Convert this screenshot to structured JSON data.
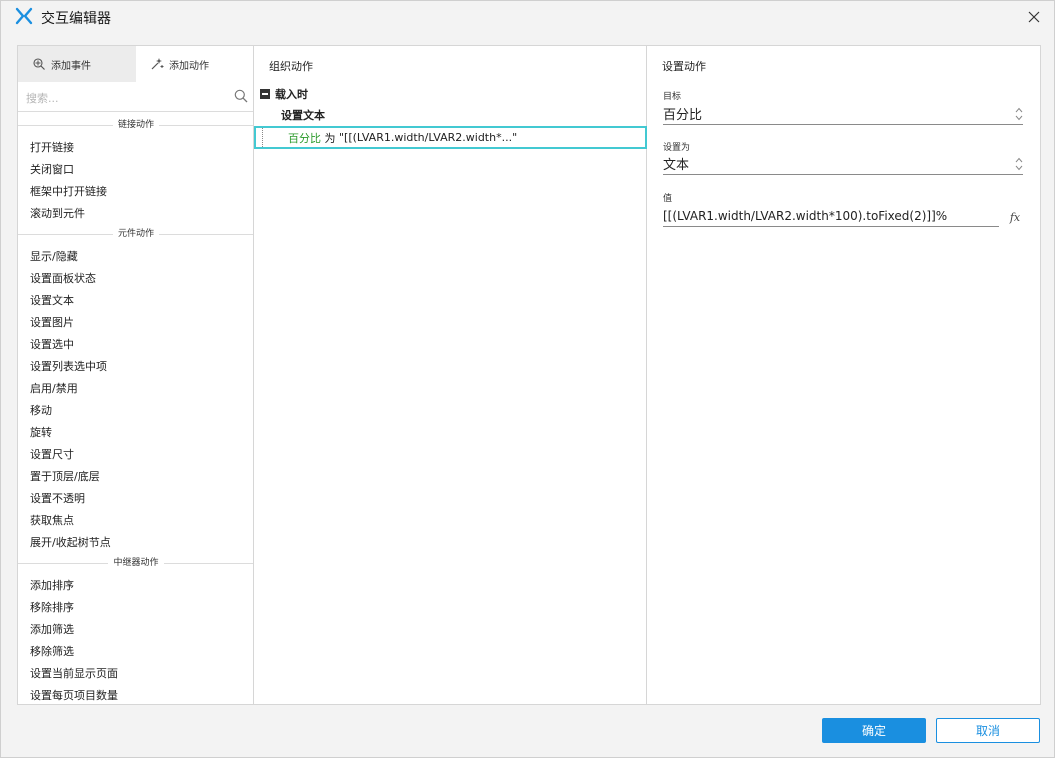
{
  "window": {
    "title": "交互编辑器",
    "accent_color": "#1a8fe0",
    "logo_color": "#1a8fe0"
  },
  "left": {
    "tabs": [
      {
        "label": "添加事件",
        "icon": "add-event-icon",
        "active": true
      },
      {
        "label": "添加动作",
        "icon": "add-action-icon",
        "active": false
      }
    ],
    "search_placeholder": "搜索...",
    "categories": [
      {
        "label": "链接动作",
        "items": [
          "打开链接",
          "关闭窗口",
          "框架中打开链接",
          "滚动到元件"
        ]
      },
      {
        "label": "元件动作",
        "items": [
          "显示/隐藏",
          "设置面板状态",
          "设置文本",
          "设置图片",
          "设置选中",
          "设置列表选中项",
          "启用/禁用",
          "移动",
          "旋转",
          "设置尺寸",
          "置于顶层/底层",
          "设置不透明",
          "获取焦点",
          "展开/收起树节点"
        ]
      },
      {
        "label": "中继器动作",
        "items": [
          "添加排序",
          "移除排序",
          "添加筛选",
          "移除筛选",
          "设置当前显示页面",
          "设置每页项目数量"
        ]
      }
    ]
  },
  "middle": {
    "header": "组织动作",
    "event_label": "载入时",
    "action_label": "设置文本",
    "detail": {
      "target": "百分比",
      "connector": " 为 ",
      "value_preview": "\"[[(LVAR1.width/LVAR2.width*...\""
    },
    "highlight_color": "#43c9d2",
    "target_color": "#2a9a2a"
  },
  "right": {
    "header": "设置动作",
    "target_label": "目标",
    "target_value": "百分比",
    "set_as_label": "设置为",
    "set_as_value": "文本",
    "value_label": "值",
    "value_text": "[[(LVAR1.width/LVAR2.width*100).toFixed(2)]]%",
    "fx_label": "fx"
  },
  "footer": {
    "ok_label": "确定",
    "cancel_label": "取消"
  }
}
